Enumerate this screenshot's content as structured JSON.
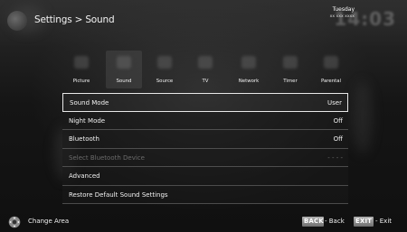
{
  "header": {
    "breadcrumb": "Settings > Sound",
    "clock": {
      "day": "Tuesday",
      "date": "xx xxx xxxx",
      "time": "14:03"
    }
  },
  "categories": [
    {
      "label": "Picture",
      "icon": "picture-icon"
    },
    {
      "label": "Sound",
      "icon": "speaker-icon",
      "active": true
    },
    {
      "label": "Source",
      "icon": "source-icon"
    },
    {
      "label": "TV",
      "icon": "tv-icon"
    },
    {
      "label": "Network",
      "icon": "network-icon"
    },
    {
      "label": "Timer",
      "icon": "timer-icon"
    },
    {
      "label": "Parental",
      "icon": "lock-icon"
    }
  ],
  "menu": [
    {
      "label": "Sound Mode",
      "value": "User"
    },
    {
      "label": "Night Mode",
      "value": "Off"
    },
    {
      "label": "Bluetooth",
      "value": "Off"
    },
    {
      "label": "Select Bluetooth Device",
      "value": "- - - -",
      "disabled": true
    },
    {
      "label": "Advanced",
      "value": ""
    },
    {
      "label": "Restore Default Sound Settings",
      "value": ""
    }
  ],
  "footer": {
    "change_area": "Change Area",
    "back_key": "BACK",
    "back_label": "- Back",
    "exit_key": "EXIT",
    "exit_label": "- Exit"
  },
  "colors": {
    "background": "#141414",
    "text": "#ffffff",
    "selection_border": "#e8e8e8",
    "key_gray": "#9a9a9a",
    "disabled_text": "#6b6b6b"
  }
}
